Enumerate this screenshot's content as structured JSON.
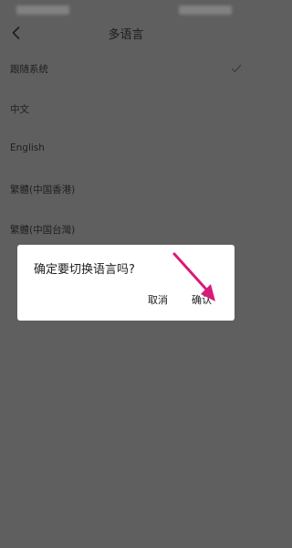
{
  "header": {
    "title": "多语言"
  },
  "languages": [
    {
      "label": "跟随系统",
      "selected": true
    },
    {
      "label": "中文",
      "selected": false
    },
    {
      "label": "English",
      "selected": false
    },
    {
      "label": "繁體(中国香港)",
      "selected": false
    },
    {
      "label": "繁體(中国台灣)",
      "selected": false
    }
  ],
  "dialog": {
    "message": "确定要切换语言吗?",
    "cancel_label": "取消",
    "confirm_label": "确认"
  },
  "colors": {
    "overlay_background": "#5f5f5f",
    "annotation_arrow": "#d81b7a",
    "check_mark": "#3a3a3a"
  },
  "icons": {
    "back": "chevron-left-icon",
    "selected": "check-icon",
    "annotation": "arrow-annotation-icon"
  }
}
